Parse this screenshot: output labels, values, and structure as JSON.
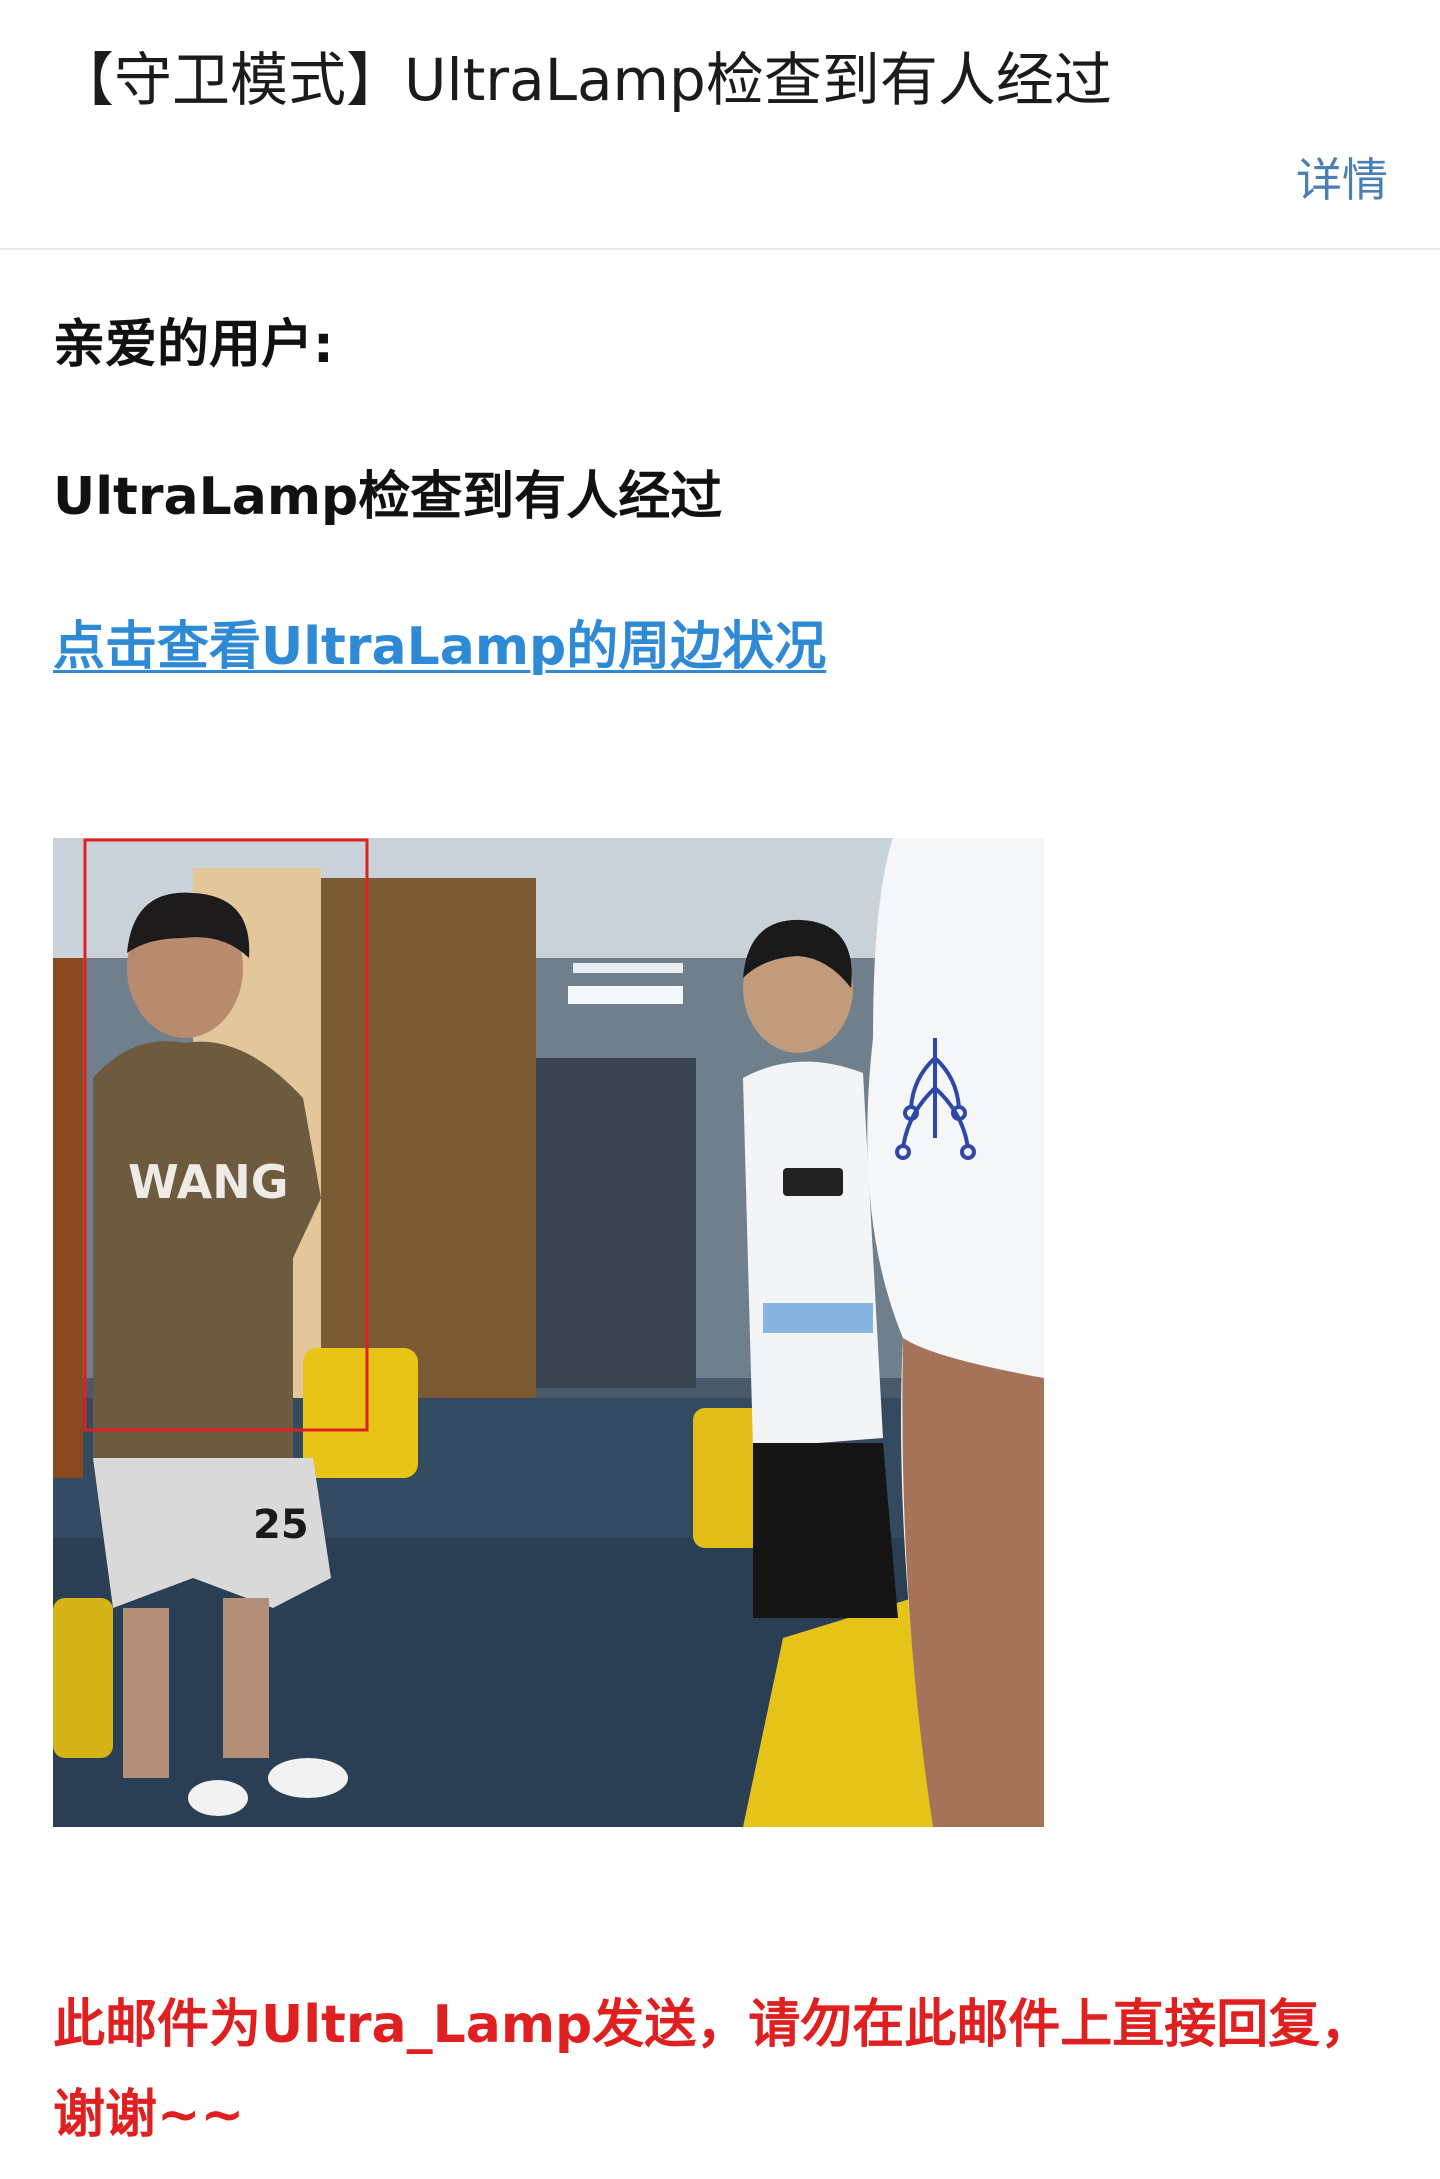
{
  "header": {
    "subject": "【守卫模式】UltraLamp检查到有人经过",
    "details_label": "详情"
  },
  "body": {
    "greeting": "亲爱的用户:",
    "message": "UltraLamp检查到有人经过",
    "view_link": "点击查看UltraLamp的周边状况",
    "shirt_text": "WANG",
    "shorts_number": "25",
    "footer_note": "此邮件为Ultra_Lamp发送，请勿在此邮件上直接回复，谢谢~~"
  },
  "colors": {
    "link": "#2f8ad6",
    "details": "#4a7fb5",
    "warning": "#e02020",
    "detection_box": "#e02020"
  }
}
